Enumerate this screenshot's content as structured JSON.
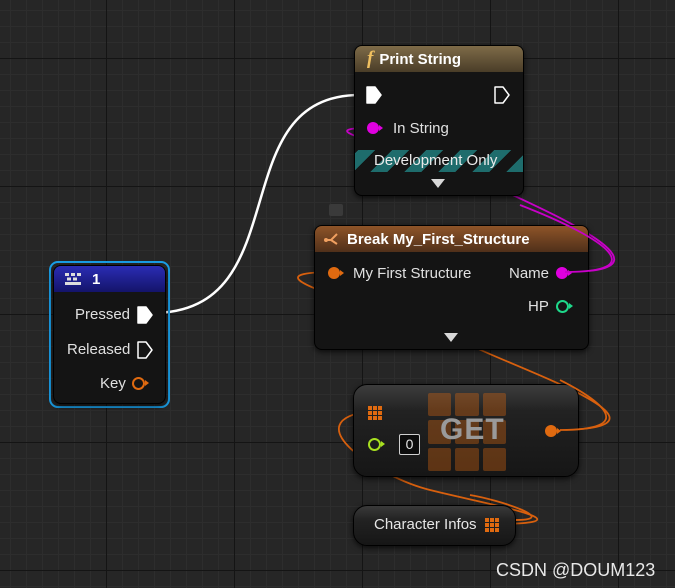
{
  "print_string": {
    "title": "Print String",
    "func_glyph": "f",
    "in_string_label": "In String",
    "dev_only_label": "Development Only"
  },
  "break_struct": {
    "title": "Break My_First_Structure",
    "input_label": "My First Structure",
    "name_label": "Name",
    "hp_label": "HP"
  },
  "key_event": {
    "title": "1",
    "pressed_label": "Pressed",
    "released_label": "Released",
    "key_label": "Key"
  },
  "get_node": {
    "title": "GET",
    "index_value": "0"
  },
  "var_node": {
    "label": "Character Infos"
  },
  "watermark": "CSDN @DOUM123",
  "colors": {
    "exec_wire": "#ffffff",
    "string_pin": "#d400d4",
    "struct_pin": "#e06a10",
    "int_pin": "#1ed88a",
    "index_pin": "#a8e020",
    "selection": "#1a9fe8",
    "print_header": "#6b5a3d",
    "break_header": "#7a4a24",
    "key_header": "#1e2090"
  }
}
